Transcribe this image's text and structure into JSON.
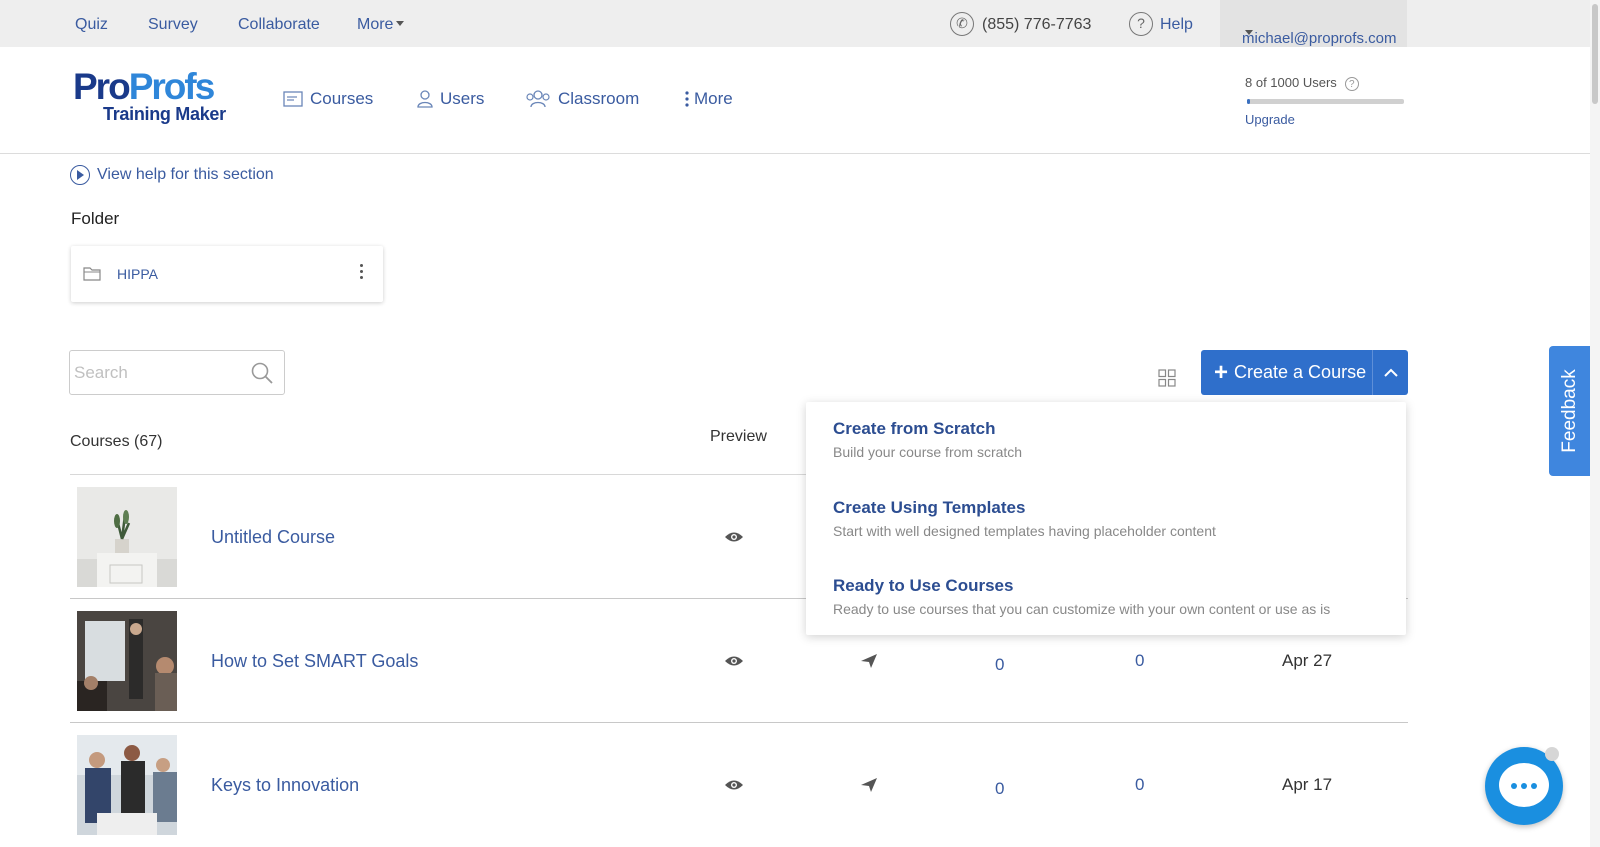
{
  "topbar": {
    "links": [
      "Quiz",
      "Survey",
      "Collaborate",
      "More"
    ],
    "phone": "(855) 776-7763",
    "help": "Help",
    "user_email": "michael@proprofs.com"
  },
  "header": {
    "logo_top_a": "Pro",
    "logo_top_b": "Profs",
    "logo_bottom": "Training Maker",
    "nav": [
      "Courses",
      "Users",
      "Classroom",
      "More"
    ],
    "users_count": "8 of 1000 Users",
    "users_fraction": 0.008,
    "upgrade": "Upgrade"
  },
  "content": {
    "help_link": "View help for this section",
    "folder_label": "Folder",
    "folder_name": "HIPPA",
    "search_placeholder": "Search",
    "create_button": "Create a Course",
    "courses_heading": "Courses (67)",
    "preview_heading": "Preview"
  },
  "dropdown": [
    {
      "title": "Create from Scratch",
      "desc": "Build your course from scratch"
    },
    {
      "title": "Create Using Templates",
      "desc": "Start with well designed templates having placeholder content"
    },
    {
      "title": "Ready to Use Courses",
      "desc": "Ready to use courses that you can customize with your own content or use as is"
    }
  ],
  "courses": [
    {
      "title": "Untitled Course",
      "v1": "",
      "v2": "",
      "date": ""
    },
    {
      "title": "How to Set SMART Goals",
      "v1": "0",
      "v2": "0",
      "date": "Apr 27"
    },
    {
      "title": "Keys to Innovation",
      "v1": "0",
      "v2": "0",
      "date": "Apr 17"
    }
  ],
  "feedback": "Feedback",
  "colors": {
    "brand_blue": "#2f6fcb",
    "link_blue": "#3a5ba0",
    "feedback_blue": "#3f86de",
    "chat_blue": "#1a8fe0"
  }
}
